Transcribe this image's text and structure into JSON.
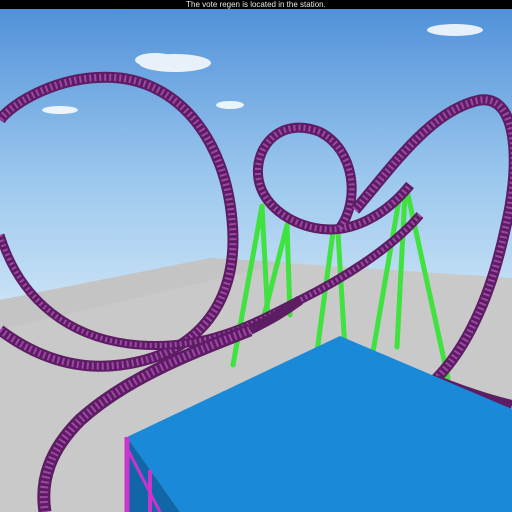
{
  "hud": {
    "message": "The vote regen is located in the station."
  },
  "scene": {
    "colors": {
      "sky_top": "#4f8fd6",
      "sky_bottom": "#bcdcf4",
      "baseplate": "#c8c8c8",
      "track": "#8a2d92",
      "track_dark": "#5c1d63",
      "supports": "#3fe03f",
      "platform_top": "#1a8ad8",
      "platform_side": "#1166a8",
      "platform_legs": "#cc33cc"
    }
  }
}
